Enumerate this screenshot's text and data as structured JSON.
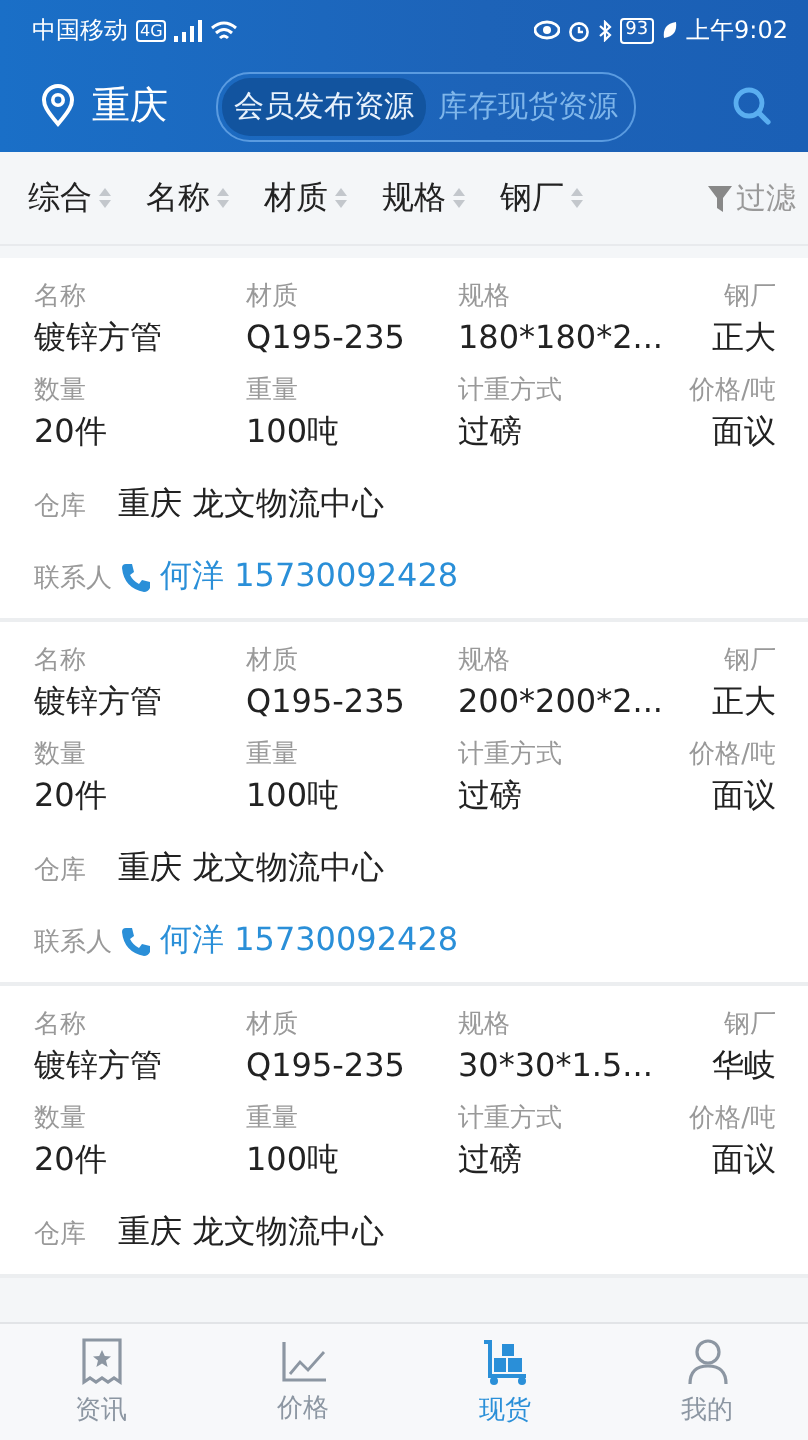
{
  "status_bar": {
    "carrier": "中国移动",
    "network": "4G",
    "battery": "93",
    "time": "上午9:02"
  },
  "header": {
    "city": "重庆",
    "segments": [
      {
        "label": "会员发布资源",
        "selected": true
      },
      {
        "label": "库存现货资源",
        "selected": false
      }
    ]
  },
  "sort_bar": {
    "items": [
      "综合",
      "名称",
      "材质",
      "规格",
      "钢厂"
    ],
    "filter": "过滤"
  },
  "listings": [
    {
      "fields": [
        {
          "label": "名称",
          "value": "镀锌方管"
        },
        {
          "label": "材质",
          "value": "Q195-235"
        },
        {
          "label": "规格",
          "value": "180*180*2..."
        },
        {
          "label": "钢厂",
          "value": "正大"
        },
        {
          "label": "数量",
          "value": "20件"
        },
        {
          "label": "重量",
          "value": "100吨"
        },
        {
          "label": "计重方式",
          "value": "过磅"
        },
        {
          "label": "价格/吨",
          "value": "面议"
        }
      ],
      "warehouse_label": "仓库",
      "warehouse": "重庆 龙文物流中心",
      "contact_label": "联系人",
      "contact": "何洋 15730092428"
    },
    {
      "fields": [
        {
          "label": "名称",
          "value": "镀锌方管"
        },
        {
          "label": "材质",
          "value": "Q195-235"
        },
        {
          "label": "规格",
          "value": "200*200*2..."
        },
        {
          "label": "钢厂",
          "value": "正大"
        },
        {
          "label": "数量",
          "value": "20件"
        },
        {
          "label": "重量",
          "value": "100吨"
        },
        {
          "label": "计重方式",
          "value": "过磅"
        },
        {
          "label": "价格/吨",
          "value": "面议"
        }
      ],
      "warehouse_label": "仓库",
      "warehouse": "重庆 龙文物流中心",
      "contact_label": "联系人",
      "contact": "何洋 15730092428"
    },
    {
      "fields": [
        {
          "label": "名称",
          "value": "镀锌方管"
        },
        {
          "label": "材质",
          "value": "Q195-235"
        },
        {
          "label": "规格",
          "value": "30*30*1.5..."
        },
        {
          "label": "钢厂",
          "value": "华岐"
        },
        {
          "label": "数量",
          "value": "20件"
        },
        {
          "label": "重量",
          "value": "100吨"
        },
        {
          "label": "计重方式",
          "value": "过磅"
        },
        {
          "label": "价格/吨",
          "value": "面议"
        }
      ],
      "warehouse_label": "仓库",
      "warehouse": "重庆 龙文物流中心"
    }
  ],
  "tab_bar": [
    {
      "label": "资讯",
      "kind": "news",
      "selected": false
    },
    {
      "label": "价格",
      "kind": "price",
      "selected": false
    },
    {
      "label": "现货",
      "kind": "stock",
      "selected": true
    },
    {
      "label": "我的",
      "kind": "me",
      "selected": false
    }
  ]
}
